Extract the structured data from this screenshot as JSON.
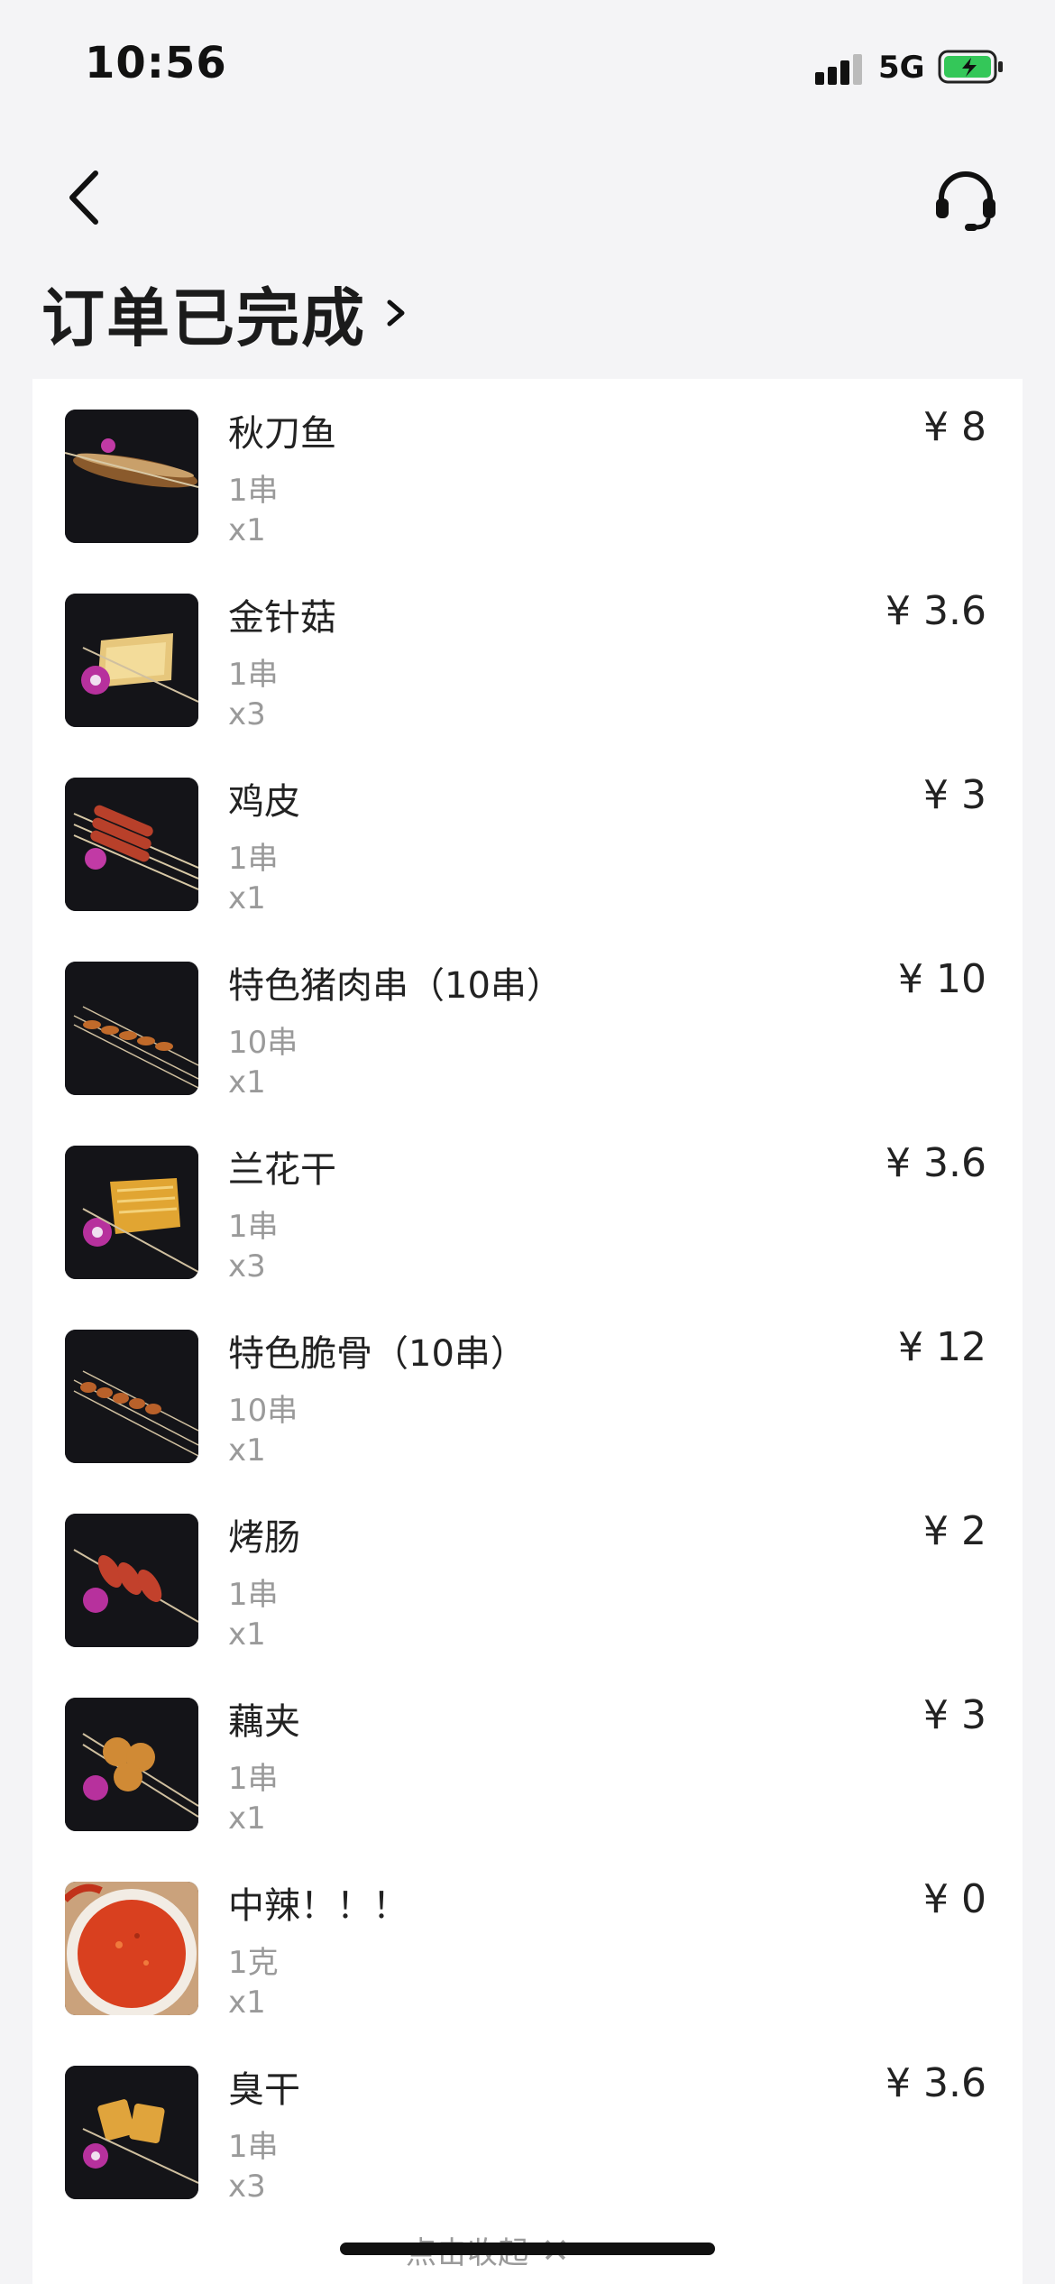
{
  "status_bar": {
    "time": "10:56",
    "network": "5G",
    "battery_color": "#34c759"
  },
  "nav": {
    "back_icon": "chevron-left-icon",
    "service_icon": "headset-icon"
  },
  "order": {
    "status_title": "订单已完成"
  },
  "items": [
    {
      "name": "秋刀鱼",
      "spec": "1串",
      "qty": "x1",
      "price": "¥ 8",
      "thumb": "grilled-fish"
    },
    {
      "name": "金针菇",
      "spec": "1串",
      "qty": "x3",
      "price": "¥ 3.6",
      "thumb": "enoki-skewer"
    },
    {
      "name": "鸡皮",
      "spec": "1串",
      "qty": "x1",
      "price": "¥ 3",
      "thumb": "chicken-skin-skewer"
    },
    {
      "name": "特色猪肉串（10串）",
      "spec": "10串",
      "qty": "x1",
      "price": "¥ 10",
      "thumb": "pork-skewers"
    },
    {
      "name": "兰花干",
      "spec": "1串",
      "qty": "x3",
      "price": "¥ 3.6",
      "thumb": "tofu-skewer"
    },
    {
      "name": "特色脆骨（10串）",
      "spec": "10串",
      "qty": "x1",
      "price": "¥ 12",
      "thumb": "cartilage-skewers"
    },
    {
      "name": "烤肠",
      "spec": "1串",
      "qty": "x1",
      "price": "¥ 2",
      "thumb": "sausage-skewer"
    },
    {
      "name": "藕夹",
      "spec": "1串",
      "qty": "x1",
      "price": "¥ 3",
      "thumb": "lotus-root-skewer"
    },
    {
      "name": "中辣！！！",
      "spec": "1克",
      "qty": "x1",
      "price": "¥ 0",
      "thumb": "chili-powder"
    },
    {
      "name": "臭干",
      "spec": "1串",
      "qty": "x3",
      "price": "¥ 3.6",
      "thumb": "stinky-tofu-skewer"
    }
  ],
  "footer": {
    "collapse_label": "点击收起",
    "collapse_icon": "close-icon"
  }
}
